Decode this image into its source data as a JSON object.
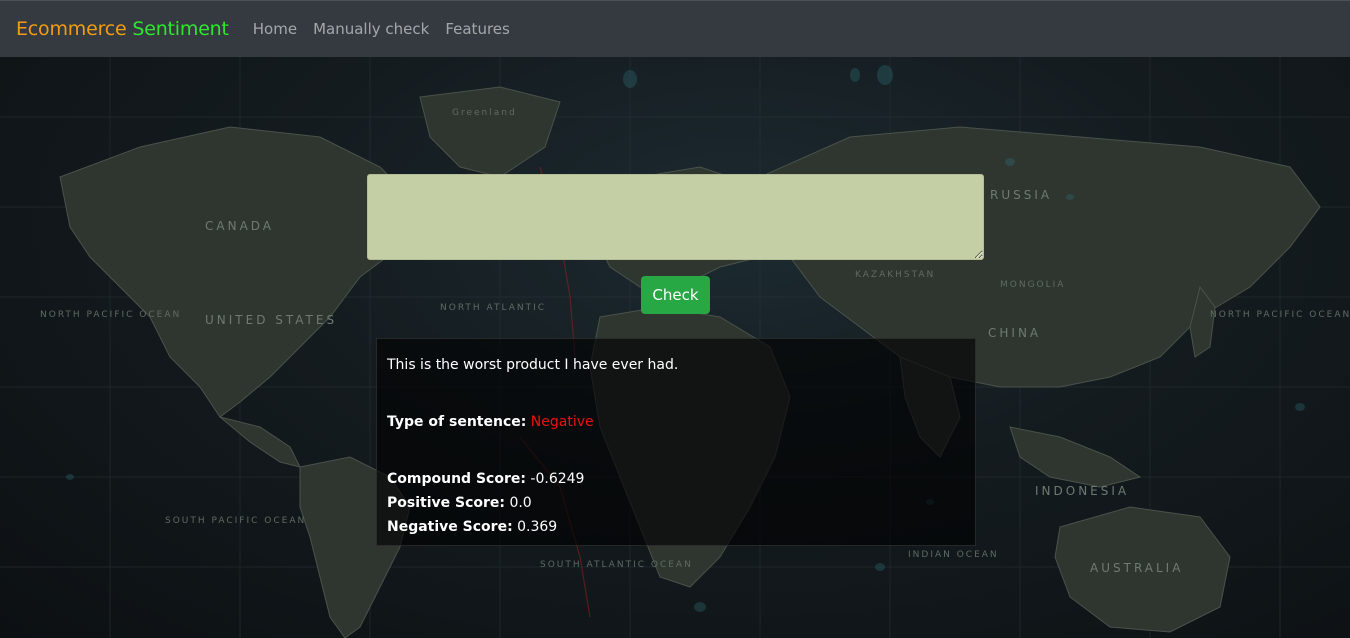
{
  "navbar": {
    "brand_part1": "Ecommerce",
    "brand_part2": "Sentiment",
    "brand_colors": {
      "part1": "#f39c12",
      "part2": "#2ee82e"
    },
    "links": [
      "Home",
      "Manually check",
      "Features"
    ]
  },
  "form": {
    "textarea_value": "",
    "button_label": "Check",
    "button_color": "#28a745"
  },
  "result": {
    "sentence": "This is the worst product I have ever had.",
    "type_label": "Type of sentence:",
    "type_value": "Negative",
    "type_color": "#ee1111",
    "compound_label": "Compound Score:",
    "compound_value": "-0.6249",
    "positive_label": "Positive Score:",
    "positive_value": "0.0",
    "negative_label": "Negative Score:",
    "negative_value": "0.369"
  },
  "map_labels": {
    "canada": "CANADA",
    "united_states": "UNITED STATES",
    "russia": "RUSSIA",
    "china": "CHINA",
    "indonesia": "INDONESIA",
    "australia": "AUSTRALIA",
    "north_atlantic": "NORTH ATLANTIC",
    "north_pacific_left": "NORTH PACIFIC OCEAN",
    "north_pacific_right": "NORTH PACIFIC OCEAN",
    "south_pacific": "SOUTH PACIFIC OCEAN",
    "south_atlantic": "SOUTH ATLANTIC OCEAN",
    "indian": "INDIAN OCEAN",
    "greenland": "Greenland",
    "mongolia": "MONGOLIA",
    "kazakhstan": "KAZAKHSTAN"
  }
}
